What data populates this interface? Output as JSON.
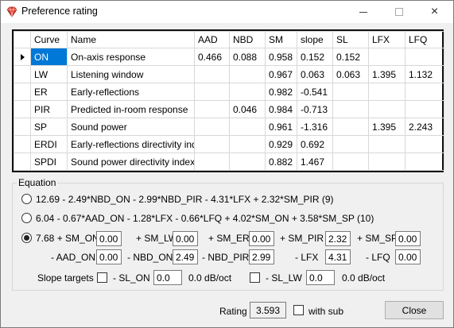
{
  "window": {
    "title": "Preference rating",
    "icon": "heart-gem-icon",
    "controls": {
      "minimize": "minimize-icon",
      "maximize": "maximize-icon",
      "close": "×"
    }
  },
  "grid": {
    "columns": [
      "",
      "Curve",
      "Name",
      "AAD",
      "NBD",
      "SM",
      "slope",
      "SL",
      "LFX",
      "LFQ"
    ],
    "rows": [
      {
        "curve": "ON",
        "name": "On-axis response",
        "aad": "0.466",
        "nbd": "0.088",
        "sm": "0.958",
        "slope": "0.152",
        "sl": "0.152",
        "lfx": "",
        "lfq": ""
      },
      {
        "curve": "LW",
        "name": "Listening window",
        "aad": "",
        "nbd": "",
        "sm": "0.967",
        "slope": "0.063",
        "sl": "0.063",
        "lfx": "1.395",
        "lfq": "1.132"
      },
      {
        "curve": "ER",
        "name": "Early-reflections",
        "aad": "",
        "nbd": "",
        "sm": "0.982",
        "slope": "-0.541",
        "sl": "",
        "lfx": "",
        "lfq": ""
      },
      {
        "curve": "PIR",
        "name": "Predicted in-room response",
        "aad": "",
        "nbd": "0.046",
        "sm": "0.984",
        "slope": "-0.713",
        "sl": "",
        "lfx": "",
        "lfq": ""
      },
      {
        "curve": "SP",
        "name": "Sound power",
        "aad": "",
        "nbd": "",
        "sm": "0.961",
        "slope": "-1.316",
        "sl": "",
        "lfx": "1.395",
        "lfq": "2.243"
      },
      {
        "curve": "ERDI",
        "name": "Early-reflections directivity index",
        "aad": "",
        "nbd": "",
        "sm": "0.929",
        "slope": "0.692",
        "sl": "",
        "lfx": "",
        "lfq": ""
      },
      {
        "curve": "SPDI",
        "name": "Sound power directivity index",
        "aad": "",
        "nbd": "",
        "sm": "0.882",
        "slope": "1.467",
        "sl": "",
        "lfx": "",
        "lfq": ""
      }
    ]
  },
  "equation": {
    "group_label": "Equation",
    "option1": "12.69 - 2.49*NBD_ON - 2.99*NBD_PIR - 4.31*LFX + 2.32*SM_PIR (9)",
    "option2": "6.04 - 0.67*AAD_ON - 1.28*LFX - 0.66*LFQ + 4.02*SM_ON + 3.58*SM_SP (10)",
    "custom": {
      "row1": [
        {
          "label": "7.68 + SM_ON",
          "value": "0.00"
        },
        {
          "label": "+ SM_LW",
          "value": "0.00"
        },
        {
          "label": "+ SM_ER",
          "value": "0.00"
        },
        {
          "label": "+ SM_PIR",
          "value": "2.32"
        },
        {
          "label": "+ SM_SP",
          "value": "0.00"
        }
      ],
      "row2": [
        {
          "label": "- AAD_ON",
          "value": "0.00"
        },
        {
          "label": "- NBD_ON",
          "value": "2.49"
        },
        {
          "label": "- NBD_PIR",
          "value": "2.99"
        },
        {
          "label": "- LFX",
          "value": "4.31"
        },
        {
          "label": "- LFQ",
          "value": "0.00"
        }
      ]
    },
    "slope_targets": {
      "label": "Slope targets",
      "sl_on_label": "- SL_ON",
      "sl_on_value": "0.0",
      "sl_on_unit": "0.0 dB/oct",
      "sl_lw_label": "- SL_LW",
      "sl_lw_value": "0.0",
      "sl_lw_unit": "0.0 dB/oct"
    }
  },
  "footer": {
    "rating_label": "Rating",
    "rating_value": "3.593",
    "with_sub_label": "with sub",
    "close_label": "Close"
  }
}
